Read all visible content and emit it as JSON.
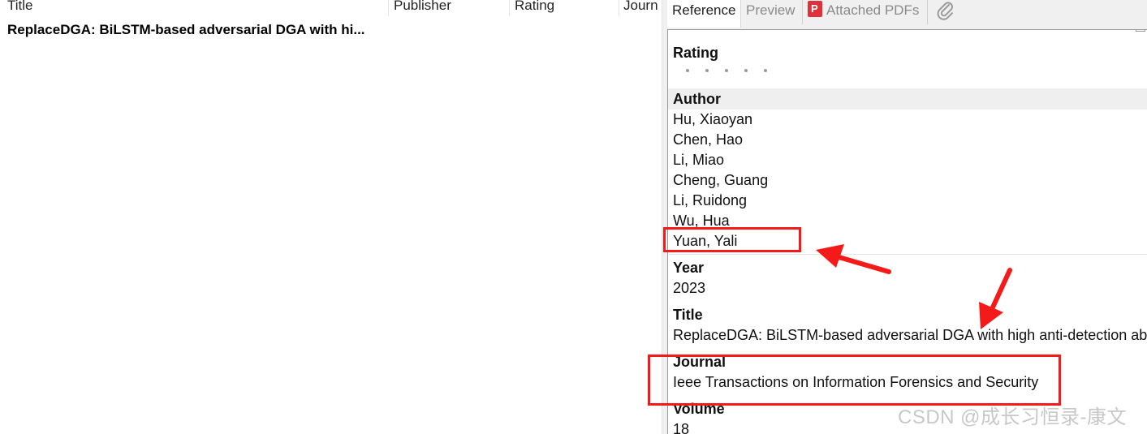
{
  "list": {
    "columns": [
      "Title",
      "Publisher",
      "Rating",
      "Journ"
    ],
    "rows": [
      {
        "title": "ReplaceDGA: BiLSTM-based adversarial DGA with hi..."
      }
    ]
  },
  "tabs": {
    "reference": "Reference",
    "preview": "Preview",
    "attached_pdfs": "Attached PDFs"
  },
  "icons": {
    "pdf": "pdf-icon",
    "attachment": "paperclip-icon"
  },
  "reference": {
    "rating_label": "Rating",
    "rating_value": 0,
    "rating_max": 5,
    "author_label": "Author",
    "authors": [
      "Hu, Xiaoyan",
      "Chen, Hao",
      "Li, Miao",
      "Cheng, Guang",
      "Li, Ruidong",
      "Wu, Hua",
      "Yuan, Yali"
    ],
    "year_label": "Year",
    "year": "2023",
    "title_label": "Title",
    "title": "ReplaceDGA: BiLSTM-based adversarial DGA with high anti-detection abilit",
    "journal_label": "Journal",
    "journal": "Ieee Transactions on Information Forensics and Security",
    "volume_label": "Volume",
    "volume": "18"
  },
  "watermark": "CSDN @成长习恒录-康文",
  "colors": {
    "annotation": "#f51a1a",
    "pdf_badge": "#e0303a"
  }
}
